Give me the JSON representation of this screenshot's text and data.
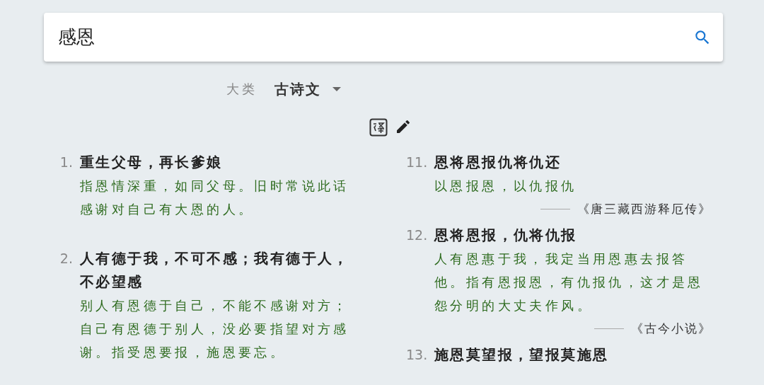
{
  "search": {
    "value": "感恩"
  },
  "filter": {
    "label": "大类",
    "value": "古诗文"
  },
  "columns": [
    {
      "items": [
        {
          "number": "1.",
          "title": "重生父母，再长爹娘",
          "meaning": "指恩情深重，如同父母。旧时常说此话感谢对自己有大恩的人。"
        },
        {
          "number": "2.",
          "title": "人有德于我，不可不感；我有德于人，不必望感",
          "meaning": "别人有恩德于自己，不能不感谢对方；自己有恩德于别人，没必要指望对方感谢。指受恩要报，施恩要忘。"
        }
      ]
    },
    {
      "items": [
        {
          "number": "11.",
          "title": "恩将恩报仇将仇还",
          "meaning": "以恩报恩，以仇报仇",
          "source": "《唐三藏西游释厄传》"
        },
        {
          "number": "12.",
          "title": "恩将恩报，仇将仇报",
          "meaning": "人有恩惠于我，我定当用恩惠去报答他。指有恩报恩，有仇报仇，这才是恩怨分明的大丈夫作风。",
          "source": "《古今小说》"
        },
        {
          "number": "13.",
          "title": "施恩莫望报，望报莫施恩"
        }
      ]
    }
  ]
}
